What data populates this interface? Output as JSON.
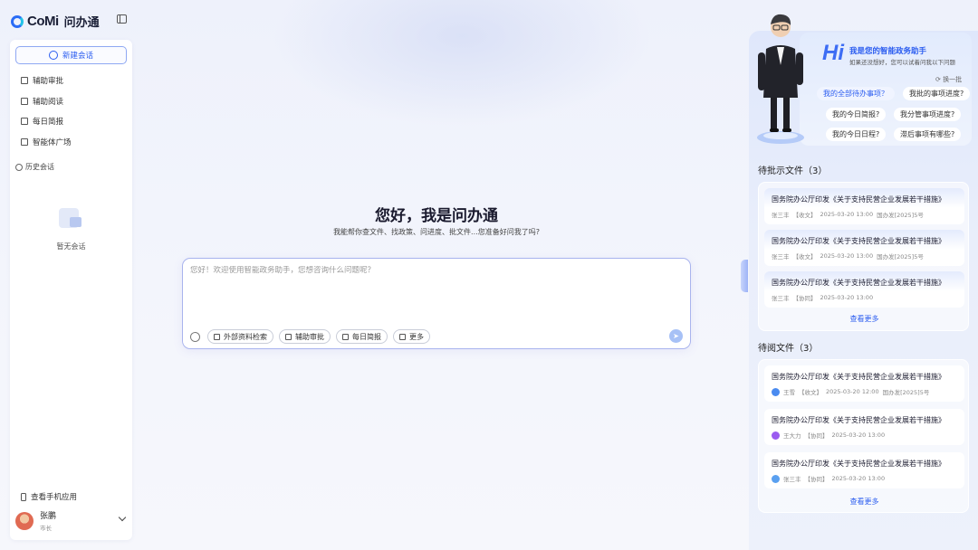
{
  "app": {
    "brand": "CoMi",
    "name": "问办通"
  },
  "sidebar": {
    "new_chat": "新建会话",
    "items": [
      {
        "label": "辅助审批"
      },
      {
        "label": "辅助阅读"
      },
      {
        "label": "每日简报"
      },
      {
        "label": "智能体广场"
      }
    ],
    "history_label": "历史会话",
    "empty_text": "暂无会话",
    "mobile_label": "查看手机应用",
    "user": {
      "name": "张鹏",
      "role": "市长"
    }
  },
  "main": {
    "greeting": "您好，我是问办通",
    "subtitle": "我能帮你查文件、找政策、问进度、批文件...您准备好问我了吗?",
    "input_placeholder": "您好！欢迎使用智能政务助手，您想咨询什么问题呢？",
    "tools": [
      {
        "label": "外部资料检索"
      },
      {
        "label": "辅助审批"
      },
      {
        "label": "每日简报"
      },
      {
        "label": "更多"
      }
    ]
  },
  "assistant": {
    "hi": "Hi",
    "title": "我是您的智能政务助手",
    "subtitle": "如果还没想好，您可以试着问我以下问题",
    "swap": "换一批",
    "suggestions": [
      "我的全部待办事项？",
      "我批的事项进度?",
      "我的今日简报?",
      "我分管事项进度?",
      "我的今日日程?",
      "滞后事项有哪些?"
    ]
  },
  "approve": {
    "title": "待批示文件（3）",
    "items": [
      {
        "title": "国务院办公厅印发《关于支持民营企业发展若干措施》",
        "user": "张三丰",
        "tag": "【收文】",
        "time": "2025-03-20 13:00",
        "doc": "国办发[2025]5号"
      },
      {
        "title": "国务院办公厅印发《关于支持民营企业发展若干措施》",
        "user": "张三丰",
        "tag": "【收文】",
        "time": "2025-03-20 13:00",
        "doc": "国办发[2025]5号"
      },
      {
        "title": "国务院办公厅印发《关于支持民营企业发展若干措施》",
        "user": "张三丰",
        "tag": "【协同】",
        "time": "2025-03-20 13:00",
        "doc": ""
      }
    ],
    "more": "查看更多"
  },
  "read": {
    "title": "待阅文件（3）",
    "items": [
      {
        "title": "国务院办公厅印发《关于支持民营企业发展若干措施》",
        "user": "王雪",
        "tag": "【收文】",
        "time": "2025-03-20 12:00",
        "doc": "国办发[2025]5号",
        "color": "#4a8bf0"
      },
      {
        "title": "国务院办公厅印发《关于支持民营企业发展若干措施》",
        "user": "王大力",
        "tag": "【协同】",
        "time": "2025-03-20 13:00",
        "doc": "",
        "color": "#9b5cf0"
      },
      {
        "title": "国务院办公厅印发《关于支持民营企业发展若干措施》",
        "user": "张三丰",
        "tag": "【协同】",
        "time": "2025-03-20 13:00",
        "doc": "",
        "color": "#5aa0f0"
      }
    ],
    "more": "查看更多"
  }
}
